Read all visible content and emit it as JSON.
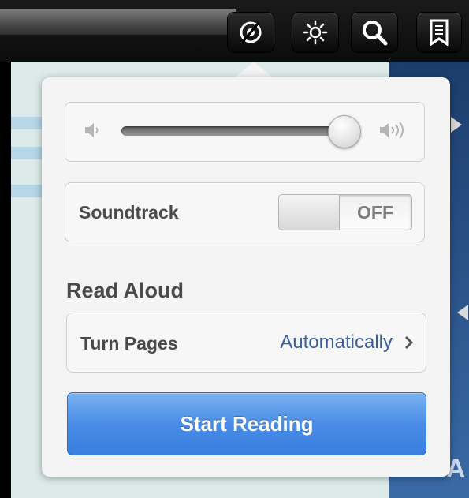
{
  "toolbar": {
    "buttons": [
      {
        "icon": "audio-icon",
        "active": true
      },
      {
        "icon": "brightness-icon"
      },
      {
        "icon": "search-icon"
      },
      {
        "icon": "bookmark-icon"
      }
    ]
  },
  "page": {
    "letter": "A"
  },
  "popover": {
    "volume": {
      "low_icon": "speaker-low-icon",
      "high_icon": "speaker-high-icon",
      "level": 0.95
    },
    "soundtrack": {
      "label": "Soundtrack",
      "toggle_state": "OFF"
    },
    "read_aloud": {
      "title": "Read Aloud",
      "turn_pages_label": "Turn Pages",
      "turn_pages_value": "Automatically"
    },
    "start_button": "Start Reading"
  },
  "colors": {
    "accent": "#4a8ce6",
    "link": "#3c5e9a",
    "label": "#4a4a4a"
  }
}
